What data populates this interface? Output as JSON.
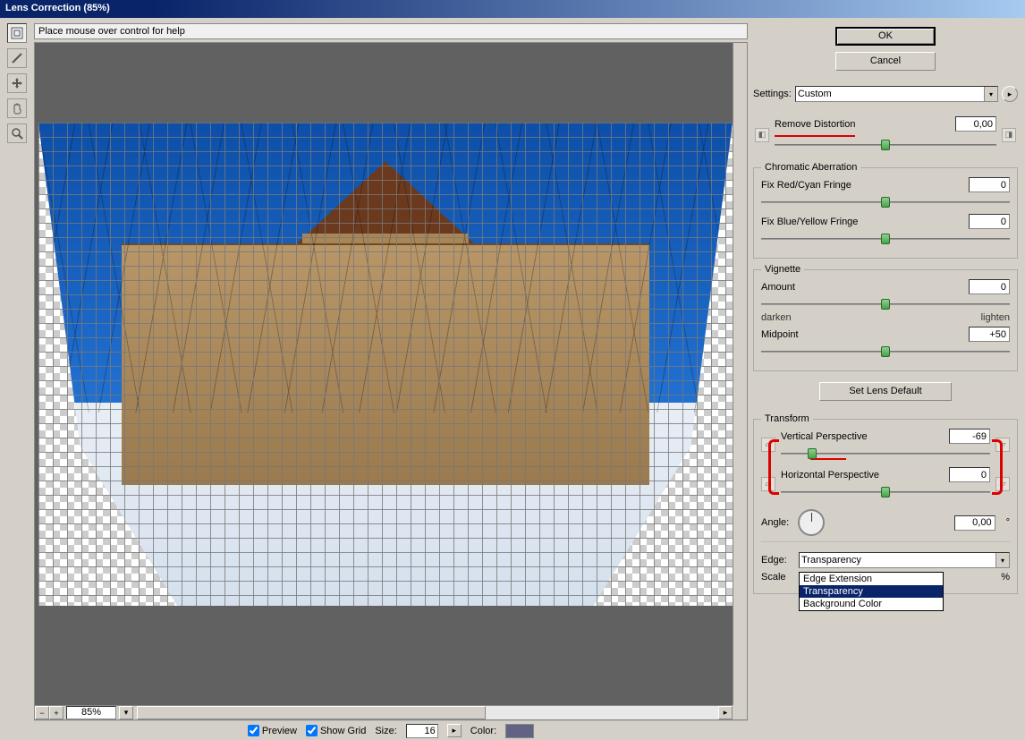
{
  "window": {
    "title": "Lens Correction (85%)"
  },
  "help_text": "Place mouse over control for help",
  "zoom": "85%",
  "bottom": {
    "preview_label": "Preview",
    "preview_checked": true,
    "grid_label": "Show Grid",
    "grid_checked": true,
    "size_label": "Size:",
    "size_value": "16",
    "color_label": "Color:"
  },
  "buttons": {
    "ok": "OK",
    "cancel": "Cancel",
    "lens_default": "Set Lens Default"
  },
  "settings": {
    "label": "Settings:",
    "value": "Custom",
    "remove_distortion_label": "Remove Distortion",
    "remove_distortion_value": "0,00"
  },
  "chromatic": {
    "title": "Chromatic Aberration",
    "red_label": "Fix Red/Cyan Fringe",
    "red_value": "0",
    "blue_label": "Fix Blue/Yellow Fringe",
    "blue_value": "0"
  },
  "vignette": {
    "title": "Vignette",
    "amount_label": "Amount",
    "amount_value": "0",
    "darken": "darken",
    "lighten": "lighten",
    "midpoint_label": "Midpoint",
    "midpoint_value": "+50"
  },
  "transform": {
    "title": "Transform",
    "vpersp_label": "Vertical Perspective",
    "vpersp_value": "-69",
    "hpersp_label": "Horizontal Perspective",
    "hpersp_value": "0",
    "angle_label": "Angle:",
    "angle_value": "0,00",
    "edge_label": "Edge:",
    "edge_value": "Transparency",
    "edge_options": [
      "Edge Extension",
      "Transparency",
      "Background Color"
    ],
    "scale_label": "Scale",
    "scale_value": "",
    "scale_pct": "%"
  }
}
